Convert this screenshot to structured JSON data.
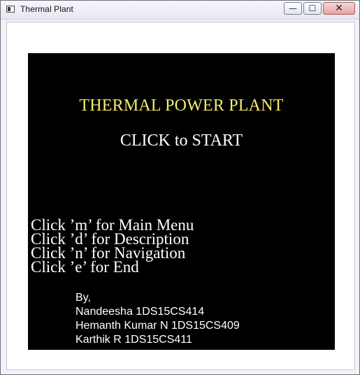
{
  "window": {
    "title": "Thermal Plant",
    "controls": {
      "minimize": "—",
      "maximize": "☐",
      "close": "✕"
    }
  },
  "screen": {
    "heading": "THERMAL POWER PLANT",
    "start_prompt": "CLICK to START",
    "help_lines": [
      "Click ’m’ for Main Menu",
      "Click ’d’ for Description",
      "Click ’n’ for Navigation",
      "Click ’e’ for End"
    ],
    "credits": {
      "by": "By,",
      "authors": [
        "Nandeesha 1DS15CS414",
        "Hemanth Kumar N 1DS15CS409",
        "Karthik R 1DS15CS411"
      ]
    }
  },
  "colors": {
    "canvas_bg": "#000000",
    "heading": "#f4ec6a",
    "text": "#ffffff"
  },
  "icons": {
    "app": "app-window-icon",
    "minimize": "minimize-icon",
    "maximize": "maximize-icon",
    "close": "close-icon"
  }
}
